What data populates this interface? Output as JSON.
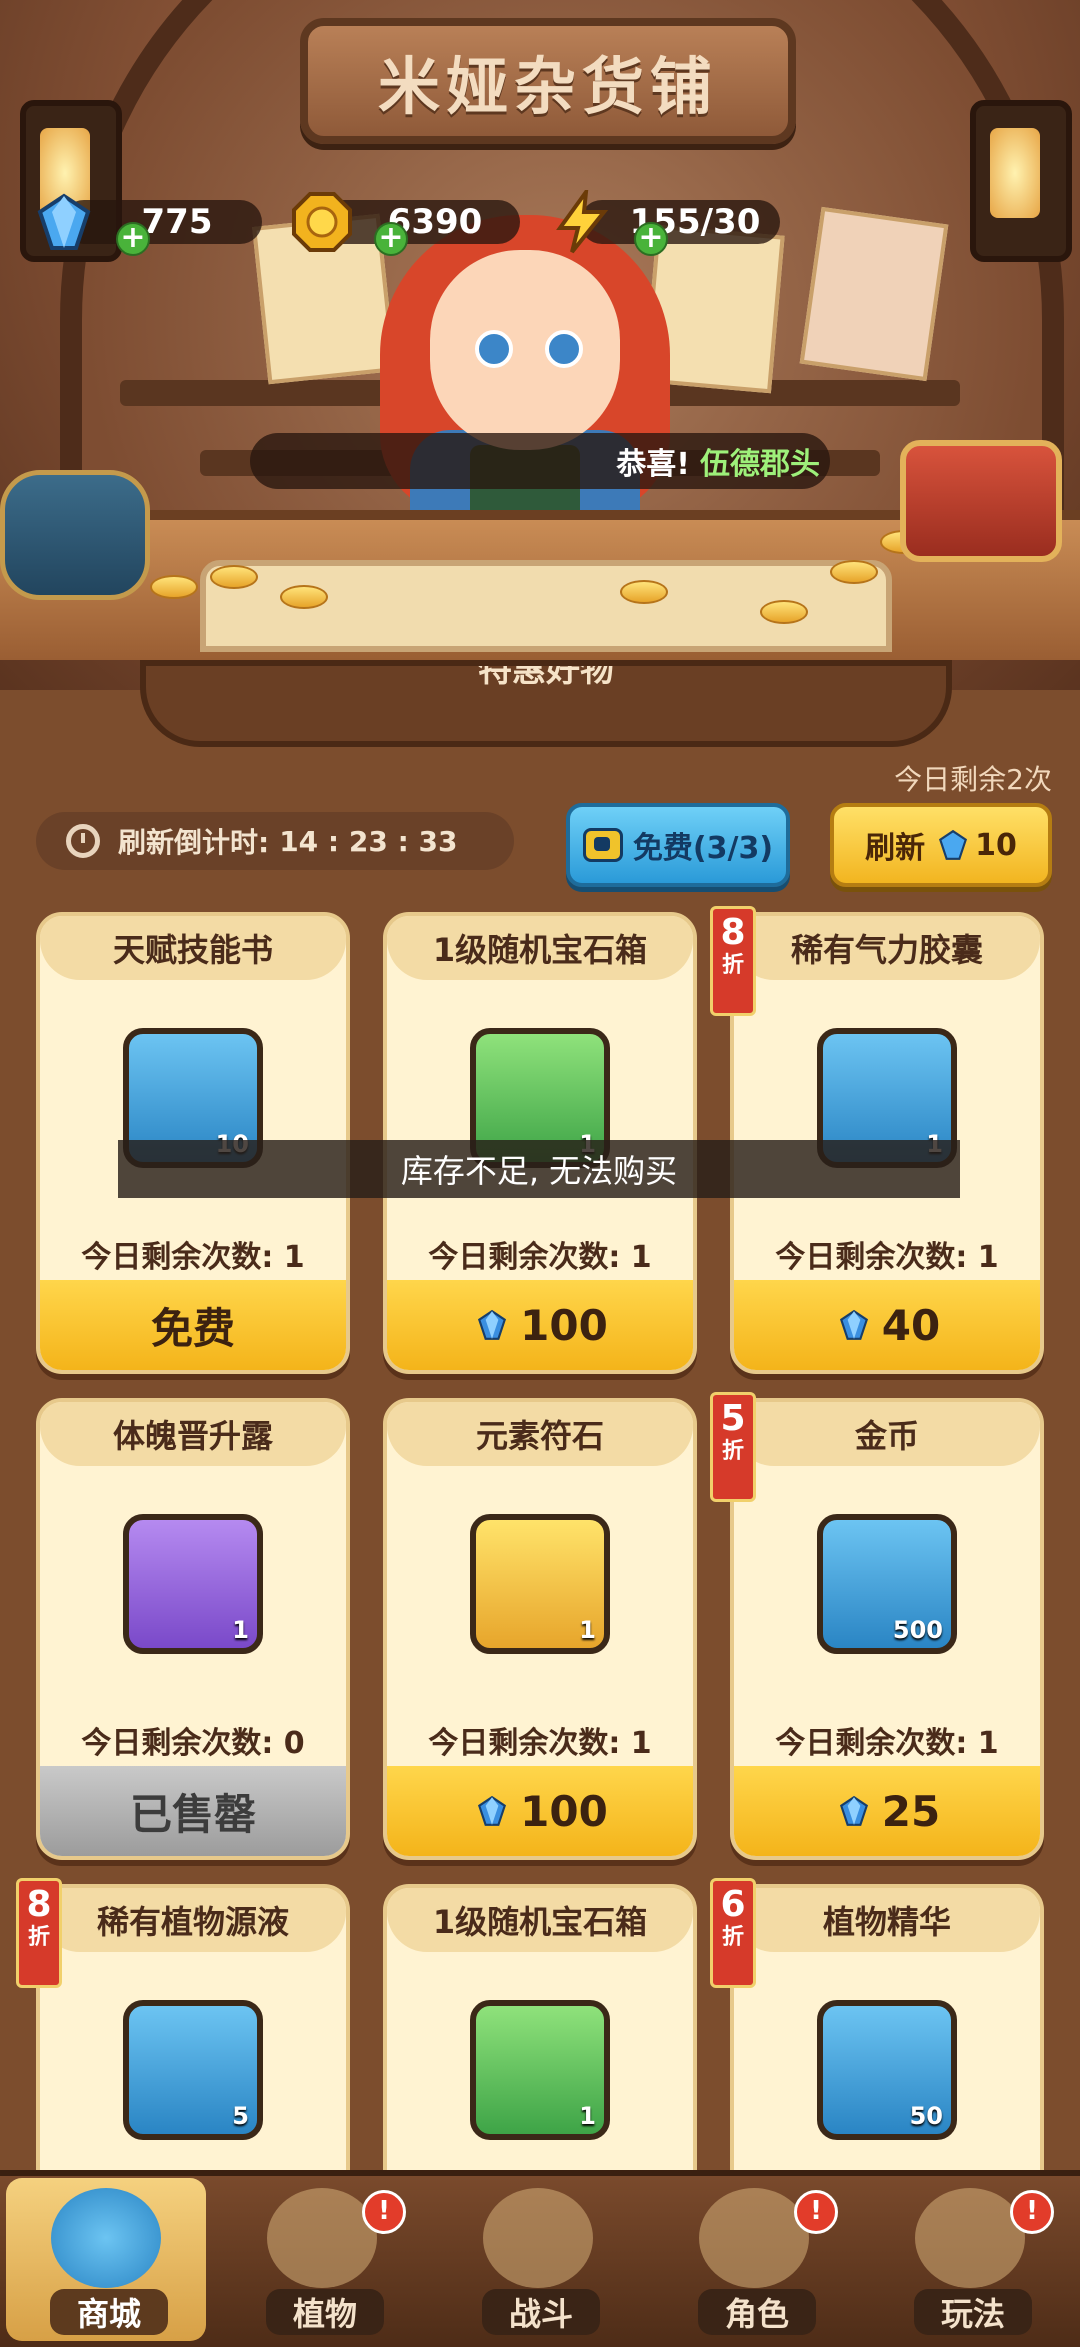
{
  "shop_title": "米娅杂货铺",
  "resources": {
    "gems": "775",
    "gold": "6390",
    "energy": "155/30"
  },
  "announcement": {
    "prefix": "恭喜!",
    "name": "伍德郡头"
  },
  "panel_tab_partial": "特惠好物",
  "daily_refresh_left": "今日剩余2次",
  "countdown": {
    "label": "刷新倒计时:",
    "time": "14 : 23 : 33"
  },
  "buttons": {
    "free_ad": "免费(3/3)",
    "refresh_label": "刷新",
    "refresh_cost": "10"
  },
  "toast": "库存不足, 无法购买",
  "items": [
    {
      "name": "天赋技能书",
      "qty": "10",
      "remaining": "今日剩余次数: 1",
      "price": "免费",
      "price_type": "free",
      "discount": null,
      "tile": "blue",
      "icon": "skill-book-icon"
    },
    {
      "name": "1级随机宝石箱",
      "qty": "1",
      "remaining": "今日剩余次数: 1",
      "price": "100",
      "price_type": "gem",
      "discount": null,
      "tile": "green",
      "icon": "mystery-gem-icon"
    },
    {
      "name": "稀有气力胶囊",
      "qty": "1",
      "remaining": "今日剩余次数: 1",
      "price": "40",
      "price_type": "gem",
      "discount": {
        "num": "8",
        "unit": "折"
      },
      "tile": "blue",
      "icon": "capsule-icon"
    },
    {
      "name": "体魄晋升露",
      "qty": "1",
      "remaining": "今日剩余次数: 0",
      "price": "已售罄",
      "price_type": "sold",
      "discount": null,
      "tile": "purple",
      "icon": "golden-drop-icon"
    },
    {
      "name": "元素符石",
      "qty": "1",
      "remaining": "今日剩余次数: 1",
      "price": "100",
      "price_type": "gem",
      "discount": null,
      "tile": "gold",
      "icon": "rune-stone-icon"
    },
    {
      "name": "金币",
      "qty": "500",
      "remaining": "今日剩余次数: 1",
      "price": "25",
      "price_type": "gem",
      "discount": {
        "num": "5",
        "unit": "折"
      },
      "tile": "blue",
      "icon": "gold-coin-icon"
    },
    {
      "name": "稀有植物源液",
      "qty": "5",
      "remaining": "",
      "price": "",
      "price_type": "hidden",
      "discount": {
        "num": "8",
        "unit": "折"
      },
      "tile": "blue",
      "icon": "potion-bottle-icon"
    },
    {
      "name": "1级随机宝石箱",
      "qty": "1",
      "remaining": "",
      "price": "",
      "price_type": "hidden",
      "discount": null,
      "tile": "green",
      "icon": "mystery-gem-icon"
    },
    {
      "name": "植物精华",
      "qty": "50",
      "remaining": "",
      "price": "",
      "price_type": "hidden",
      "discount": {
        "num": "6",
        "unit": "折"
      },
      "tile": "blue",
      "icon": "essence-orb-icon"
    }
  ],
  "nav": [
    {
      "label": "商城",
      "active": true,
      "badge": false,
      "icon": "shop-icon"
    },
    {
      "label": "植物",
      "active": false,
      "badge": true,
      "icon": "plant-icon"
    },
    {
      "label": "战斗",
      "active": false,
      "badge": false,
      "icon": "battle-icon"
    },
    {
      "label": "角色",
      "active": false,
      "badge": true,
      "icon": "character-icon"
    },
    {
      "label": "玩法",
      "active": false,
      "badge": true,
      "icon": "gameplay-icon"
    }
  ],
  "badge_symbol": "!",
  "colors": {
    "gem_blue": "#3a8fe0",
    "price_yellow": "#f4b41a",
    "discount_red": "#d63a2a",
    "ad_button_blue": "#2a9ad8"
  }
}
